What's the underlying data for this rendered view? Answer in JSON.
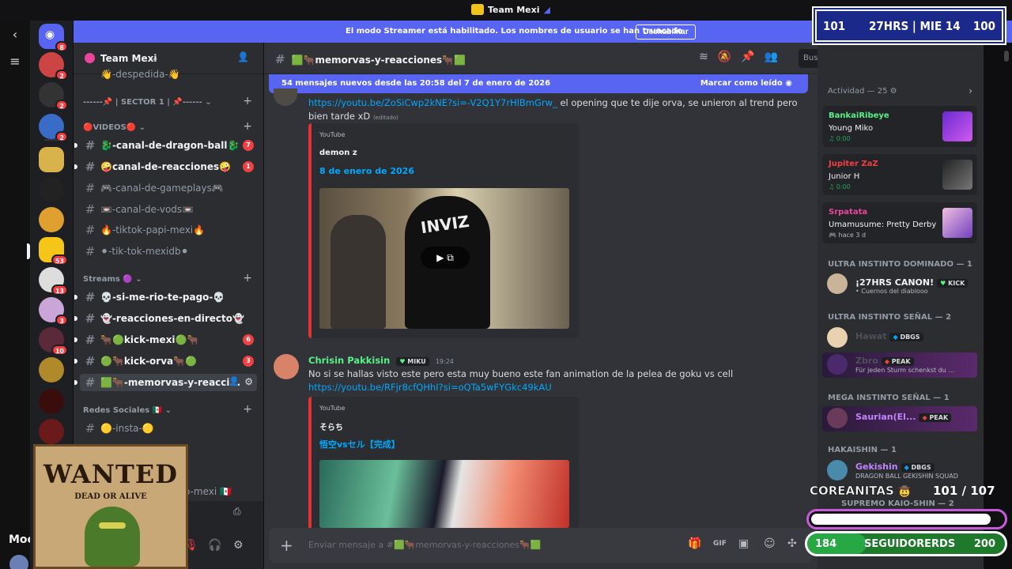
{
  "window": {
    "title": "Team Mexi"
  },
  "banner": {
    "message": "El modo Streamer está habilitado. Los nombres de usuario se han truncado.",
    "button": "Deshabilitar"
  },
  "hud": {
    "left": "101",
    "center": "27HRS | MIE 14",
    "right": "100"
  },
  "strip": {
    "label": "Moc"
  },
  "servers": {
    "badges": [
      "8",
      "2",
      "2",
      "2",
      "53",
      "13",
      "3",
      "10"
    ]
  },
  "sidebar": {
    "server_name": "Team Mexi",
    "top_channel": "👋-despedida-👋",
    "categories": [
      {
        "label": "------📌 | SECTOR 1 | 📌------"
      },
      {
        "label": "🔴VIDEOS🔴"
      },
      {
        "label": "Streams 🟣"
      },
      {
        "label": "Redes Sociales 🇲🇽"
      }
    ],
    "channels": [
      {
        "label": "🐉-canal-de-dragon-ball🐉",
        "badge": "7"
      },
      {
        "label": "🤪canal-de-reacciones🤪",
        "badge": "1"
      },
      {
        "label": "🎮-canal-de-gameplays🎮",
        "badge": ""
      },
      {
        "label": "📼-canal-de-vods📼",
        "badge": ""
      },
      {
        "label": "🔥-tiktok-papi-mexi🔥",
        "badge": ""
      },
      {
        "label": "⚫-tik-tok-mexidb⚫",
        "badge": ""
      },
      {
        "label": "💀-si-me-rio-te-pago-💀",
        "badge": ""
      },
      {
        "label": "👻-reacciones-en-directo👻",
        "badge": ""
      },
      {
        "label": "🐂🟢kick-mexi🟢🐂",
        "badge": "6"
      },
      {
        "label": "🟢🐂kick-orva🐂🟢",
        "badge": "3"
      },
      {
        "label": "🟩🐂-memorvas-y-reacci...",
        "badge": ""
      },
      {
        "label": "🟡-insta-🟡",
        "badge": ""
      }
    ],
    "partial_channel": "o-mexi 🇲🇽"
  },
  "channel_header": {
    "name": "🟩🐂memorvas-y-reacciones🐂🟩",
    "search_placeholder": "Buscar Team Mexi"
  },
  "new_messages": {
    "text": "54 mensajes nuevos desde las 20:58 del 7 de enero de 2026",
    "action": "Marcar como leído"
  },
  "messages": [
    {
      "link": "https://youtu.be/ZoSiCwp2kNE?si=-V2Q1Y7rHlBmGrw_",
      "text": " el opening que te dije orva, se unieron al trend pero bien tarde xD",
      "edited": "(editado)",
      "embed": {
        "provider": "YouTube",
        "author": "demon z",
        "title": "8 de enero de 2026"
      }
    },
    {
      "author": "Chrisin Pakkisin",
      "tag": "MIKU",
      "time": "19:24",
      "text": "No si se hallas visto este pero esta muy bueno este fan animation de la pelea de goku vs cell",
      "link": "https://youtu.be/RFjr8cfQHhI?si=oQTa5wFYGkc49kAU",
      "embed": {
        "provider": "YouTube",
        "author": "そらち",
        "title": "悟空vsセル【完成】"
      }
    }
  ],
  "composer": {
    "placeholder": "Enviar mensaje a #🟩🐂memorvas-y-reacciones🐂🟩"
  },
  "members": {
    "activity_header": "Actividad — 25",
    "activities": [
      {
        "user": "BankaiRibeye",
        "game": "Young Miko",
        "status": "0:00",
        "color": "#57f287"
      },
      {
        "user": "Jupiter ZaZ",
        "game": "Junior H",
        "status": "0:00",
        "color": "#f23f43"
      },
      {
        "user": "Srpatata",
        "game": "Umamusume: Pretty Derby",
        "status": "hace 3 d",
        "color": "#eb459e"
      }
    ],
    "groups": [
      {
        "header": "ULTRA INSTINTO DOMINADO — 1",
        "members": [
          {
            "name": "¡27HRS CANON!",
            "tag": "KICK",
            "sub": "• Cuernos del diablooo",
            "color": "#f2f3f5"
          }
        ]
      },
      {
        "header": "ULTRA INSTINTO SEÑAL — 2",
        "members": [
          {
            "name": "Hawat",
            "tag": "DBGS",
            "sub": "",
            "color": "#4e5058"
          },
          {
            "name": "Zbro",
            "tag": "PEAK",
            "sub": "Für jeden Sturm schenkst du ...",
            "color": "#4e5058"
          }
        ]
      },
      {
        "header": "MEGA INSTINTO SEÑAL — 1",
        "members": [
          {
            "name": "Saurian(El...",
            "tag": "PEAK",
            "sub": "",
            "color": "#c084fc"
          }
        ]
      },
      {
        "header": "HAKAISHIN — 1",
        "members": [
          {
            "name": "Gekishin",
            "tag": "DBGS",
            "sub": "DRAGON BALL GEKISHIN SQUAD",
            "color": "#c084fc"
          }
        ]
      },
      {
        "header": "SUPREMO KAIO-SHIN — 2",
        "members": []
      }
    ]
  },
  "overlay": {
    "wanted_title": "WANTED",
    "wanted_sub": "DEAD OR ALIVE",
    "coreanitas": "COREANITAS",
    "coreanitas_count": "101  /  107",
    "coreanitas_progress": 0.94,
    "followers_left": "184",
    "followers_label": "SEGUIDORERDS",
    "followers_right": "200",
    "followers_progress": 0.3
  },
  "colors": {
    "blurple": "#5865f2",
    "link": "#00a8fc",
    "danger": "#f23f43",
    "online": "#23a55a"
  }
}
